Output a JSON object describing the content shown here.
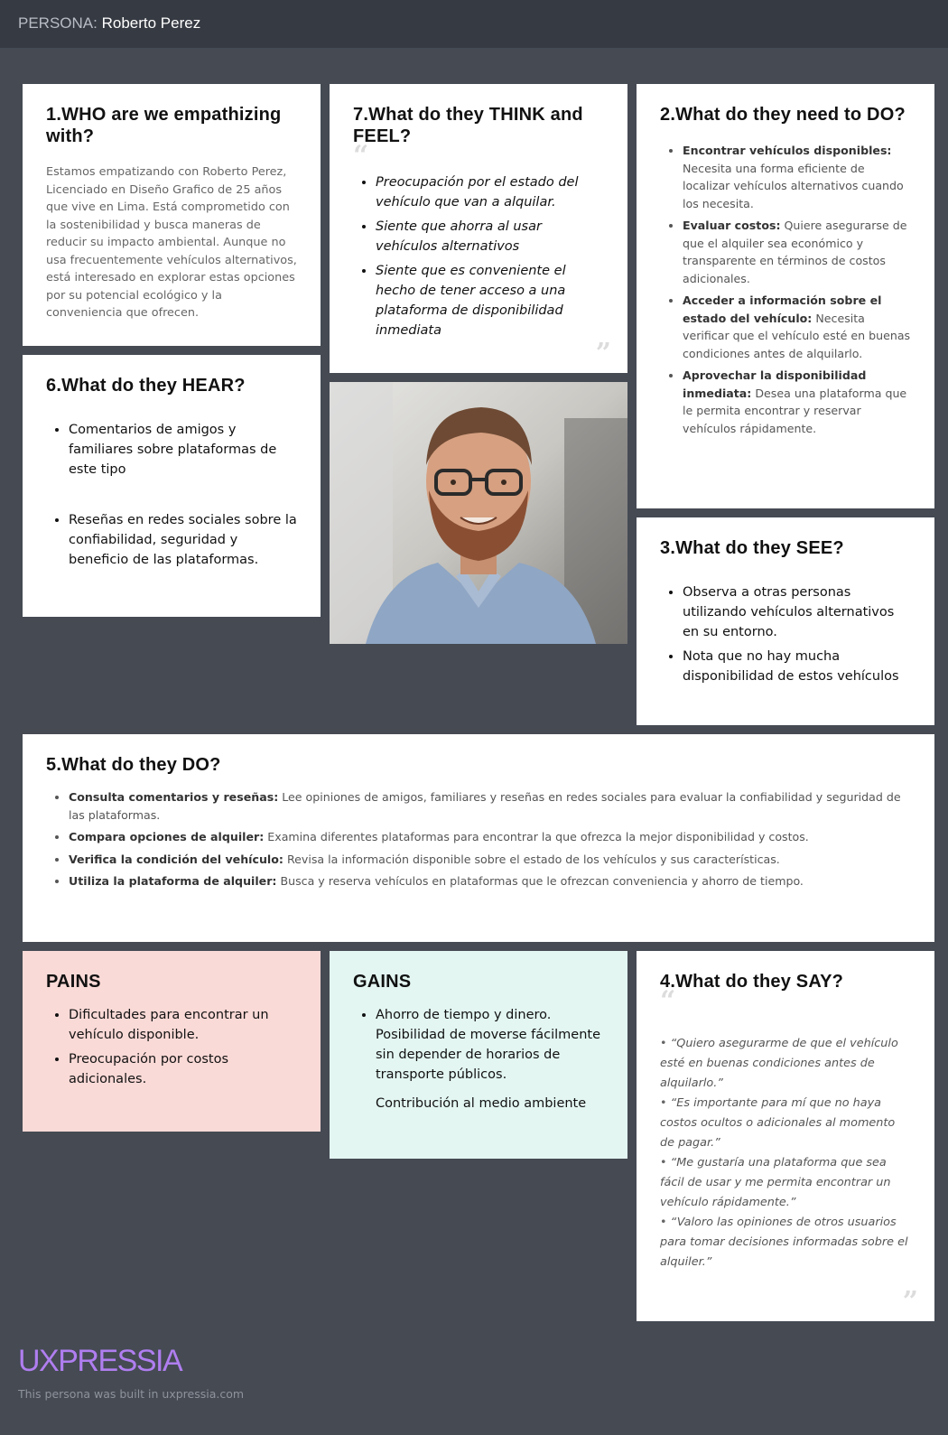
{
  "header": {
    "prefix": "PERSONA:",
    "name": "Roberto Perez"
  },
  "who": {
    "title": "1.WHO are we empathizing with?",
    "text": "Estamos empatizando con Roberto Perez, Licenciado en Diseño Grafico de 25 años que vive en Lima. Está comprometido con la sostenibilidad y busca maneras de reducir su impacto ambiental. Aunque no usa frecuentemente vehículos alternativos, está interesado en explorar estas opciones por su potencial ecológico y la conveniencia que ofrecen."
  },
  "think": {
    "title": "7.What do they THINK and FEEL?",
    "items": [
      " Preocupación por el estado del vehículo que van a alquilar.",
      "Siente que ahorra al usar vehículos alternativos",
      "Siente que es conveniente el hecho de tener acceso a una plataforma de disponibilidad inmediata"
    ]
  },
  "need": {
    "title": "2.What do they need to DO?",
    "items": [
      {
        "bold": "Encontrar vehículos disponibles:",
        "text": " Necesita una forma eficiente de localizar vehículos alternativos cuando los necesita."
      },
      {
        "bold": "Evaluar costos:",
        "text": " Quiere asegurarse de que el alquiler sea económico y transparente en términos de costos adicionales."
      },
      {
        "bold": "Acceder a información sobre el estado del vehículo:",
        "text": " Necesita verificar que el vehículo esté en buenas condiciones antes de alquilarlo."
      },
      {
        "bold": "Aprovechar la disponibilidad inmediata:",
        "text": " Desea una plataforma que le permita encontrar y reservar vehículos rápidamente."
      }
    ]
  },
  "hear": {
    "title": "6.What do they HEAR?",
    "items": [
      "Comentarios de amigos y familiares sobre plataformas de este tipo",
      "Reseñas en redes sociales sobre la confiabilidad, seguridad y beneficio de las plataformas."
    ]
  },
  "see": {
    "title": "3.What do they SEE?",
    "items": [
      "Observa a otras personas utilizando vehículos alternativos en su entorno.",
      "Nota que no hay mucha disponibilidad de estos vehículos"
    ]
  },
  "do": {
    "title": "5.What do they DO?",
    "items": [
      {
        "bold": "Consulta comentarios y reseñas:",
        "text": " Lee opiniones de amigos, familiares y reseñas en redes sociales para evaluar la confiabilidad y seguridad de las plataformas."
      },
      {
        "bold": "Compara opciones de alquiler:",
        "text": " Examina diferentes plataformas para encontrar la que ofrezca la mejor disponibilidad y costos."
      },
      {
        "bold": "Verifica la condición del vehículo:",
        "text": " Revisa la información disponible sobre el estado de los vehículos y sus características."
      },
      {
        "bold": "Utiliza la plataforma de alquiler:",
        "text": " Busca y reserva vehículos en plataformas que le ofrezcan conveniencia y ahorro de tiempo."
      }
    ]
  },
  "pains": {
    "title": "PAINS",
    "items": [
      "Dificultades para encontrar un vehículo disponible.",
      "Preocupación por costos adicionales."
    ]
  },
  "gains": {
    "title": "GAINS",
    "item": "Ahorro de tiempo y dinero. Posibilidad de moverse fácilmente sin depender de horarios de transporte públicos.",
    "extra": "Contribución al medio ambiente"
  },
  "say": {
    "title": "4.What do they SAY?",
    "items": [
      "“Quiero asegurarme de que el vehículo esté en buenas condiciones antes de alquilarlo.”",
      "“Es importante para mí que no haya costos ocultos o adicionales al momento de pagar.”",
      "“Me gustaría una plataforma que sea fácil de usar y me permita encontrar un vehículo rápidamente.”",
      "“Valoro las opiniones de otros usuarios para tomar decisiones informadas sobre el alquiler.”"
    ]
  },
  "footer": {
    "brand": "UXPRESSIA",
    "built": "This persona was built in uxpressia.com"
  },
  "colors": {
    "background": "#454a53",
    "pains": "#fadad7",
    "gains": "#e3f6f2",
    "brand": "#b07ef0"
  }
}
